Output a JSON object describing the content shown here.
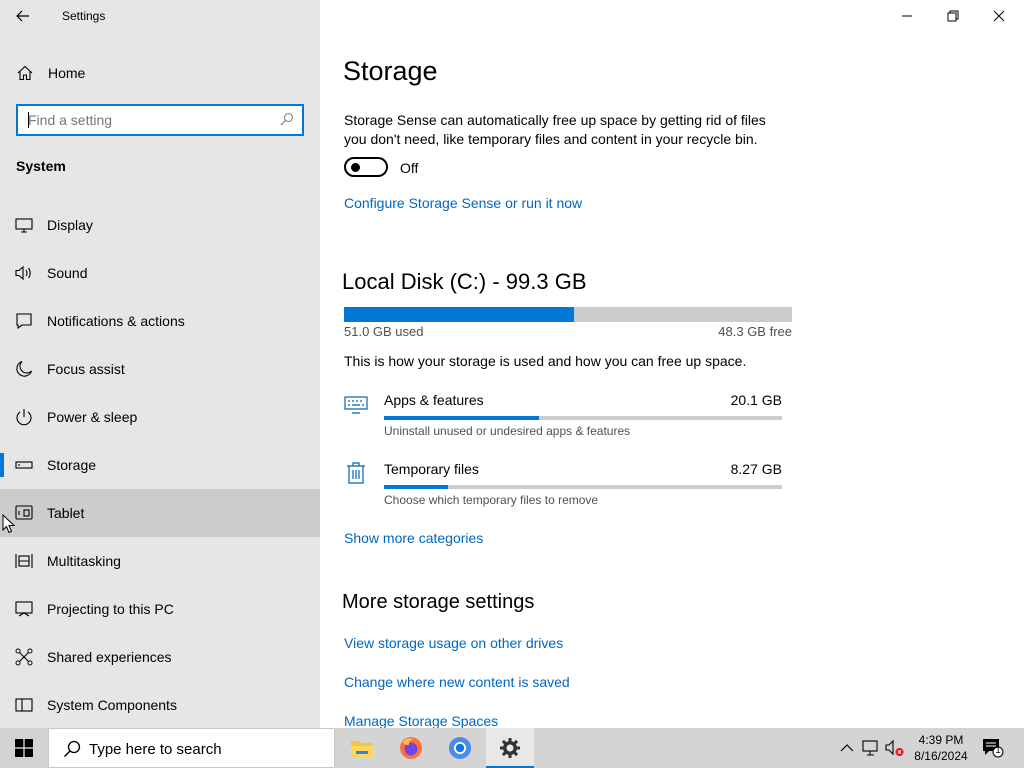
{
  "window": {
    "title": "Settings"
  },
  "sidebar": {
    "home_label": "Home",
    "search_placeholder": "Find a setting",
    "section_title": "System",
    "items": [
      {
        "label": "Display",
        "icon": "display-icon"
      },
      {
        "label": "Sound",
        "icon": "sound-icon"
      },
      {
        "label": "Notifications & actions",
        "icon": "notifications-icon"
      },
      {
        "label": "Focus assist",
        "icon": "focus-assist-icon"
      },
      {
        "label": "Power & sleep",
        "icon": "power-icon"
      },
      {
        "label": "Storage",
        "icon": "storage-icon",
        "selected": true
      },
      {
        "label": "Tablet",
        "icon": "tablet-icon",
        "hovered": true
      },
      {
        "label": "Multitasking",
        "icon": "multitasking-icon"
      },
      {
        "label": "Projecting to this PC",
        "icon": "projecting-icon"
      },
      {
        "label": "Shared experiences",
        "icon": "shared-experiences-icon"
      },
      {
        "label": "System Components",
        "icon": "system-components-icon"
      }
    ]
  },
  "main": {
    "title": "Storage",
    "description": "Storage Sense can automatically free up space by getting rid of files you don't need, like temporary files and content in your recycle bin.",
    "toggle_state": "Off",
    "configure_link": "Configure Storage Sense or run it now",
    "disk": {
      "title": "Local Disk (C:) - 99.3 GB",
      "used_label": "51.0 GB used",
      "free_label": "48.3 GB free",
      "used_fraction": 0.514
    },
    "how_text": "This is how your storage is used and how you can free up space.",
    "categories": [
      {
        "name": "Apps & features",
        "size": "20.1 GB",
        "sub": "Uninstall unused or undesired apps & features",
        "fraction": 0.39,
        "icon": "apps-features-icon"
      },
      {
        "name": "Temporary files",
        "size": "8.27 GB",
        "sub": "Choose which temporary files to remove",
        "fraction": 0.16,
        "icon": "trash-icon"
      }
    ],
    "show_more_link": "Show more categories",
    "more_title": "More storage settings",
    "more_links": [
      "View storage usage on other drives",
      "Change where new content is saved",
      "Manage Storage Spaces"
    ]
  },
  "taskbar": {
    "search_placeholder": "Type here to search",
    "time": "4:39 PM",
    "date": "8/16/2024",
    "notification_count": "1"
  },
  "colors": {
    "accent": "#0078d7",
    "link": "#0067c0",
    "sidebar_bg": "#e6e6e6"
  }
}
